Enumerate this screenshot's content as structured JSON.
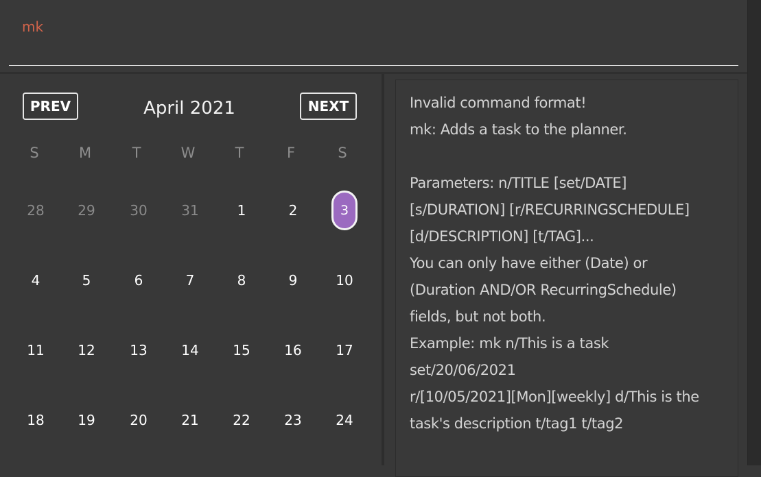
{
  "command_box": {
    "value": "mk"
  },
  "calendar": {
    "prev_label": "PREV",
    "next_label": "NEXT",
    "month_title": "April 2021",
    "weekdays": [
      "S",
      "M",
      "T",
      "W",
      "T",
      "F",
      "S"
    ],
    "weeks": [
      [
        "28",
        "29",
        "30",
        "31",
        "1",
        "2",
        "3"
      ],
      [
        "4",
        "5",
        "6",
        "7",
        "8",
        "9",
        "10"
      ],
      [
        "11",
        "12",
        "13",
        "14",
        "15",
        "16",
        "17"
      ],
      [
        "18",
        "19",
        "20",
        "21",
        "22",
        "23",
        "24"
      ]
    ],
    "selected_day": "3",
    "selected_color": "#9b6ac0"
  },
  "result_display": {
    "lines": [
      "Invalid command format!",
      "mk: Adds a task to the planner.",
      "",
      "Parameters: n/TITLE [set/DATE]",
      "[s/DURATION] [r/RECURRINGSCHEDULE]",
      "[d/DESCRIPTION] [t/TAG]...",
      "You can only have either (Date) or",
      "(Duration AND/OR RecurringSchedule)",
      "fields, but not both.",
      "Example: mk n/This is a task",
      "set/20/06/2021",
      "r/[10/05/2021][Mon][weekly] d/This is the",
      "task's description t/tag1 t/tag2"
    ]
  },
  "colors": {
    "background": "#383838",
    "command_text": "#d0634a",
    "accent": "#9b6ac0"
  }
}
